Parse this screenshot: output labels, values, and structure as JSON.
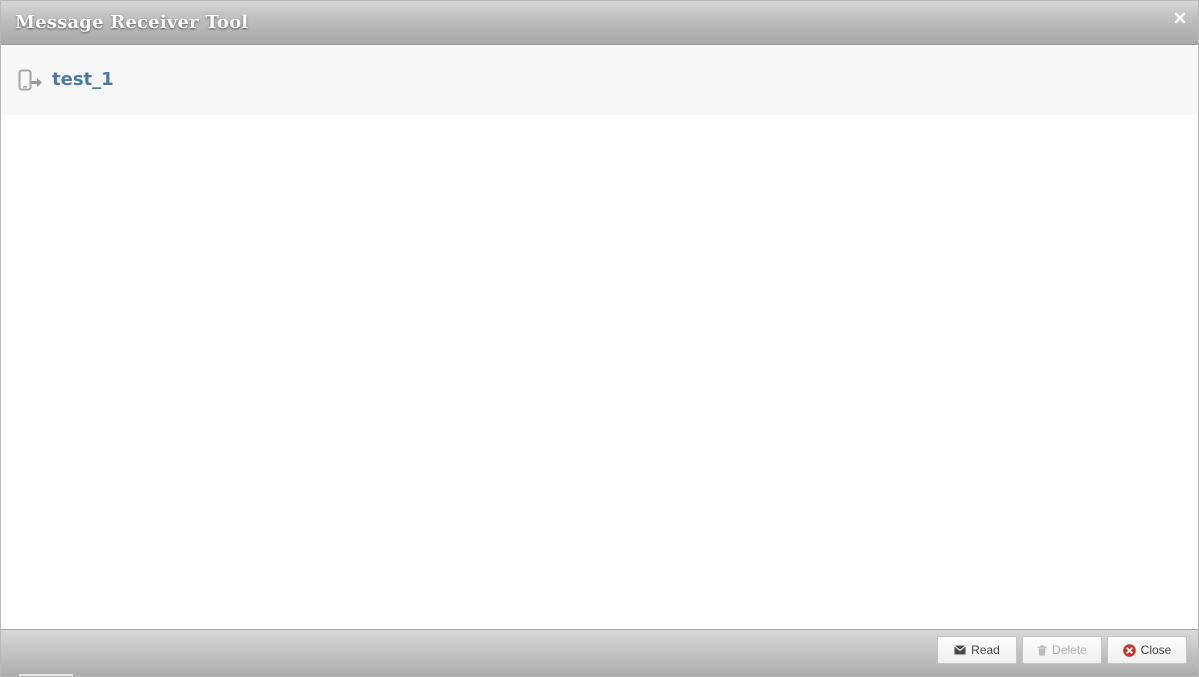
{
  "window": {
    "title": "Message Receiver Tool"
  },
  "device": {
    "name": "test_1"
  },
  "footer": {
    "read_label": "Read",
    "delete_label": "Delete",
    "close_label": "Close"
  },
  "icons": {
    "close": "close-x-icon",
    "device": "mobile-arrow-icon",
    "read": "envelope-icon",
    "delete": "trash-icon",
    "close_button": "circle-x-icon"
  },
  "colors": {
    "device_name": "#4a7aaa",
    "close_button_icon": "#c0392b"
  }
}
